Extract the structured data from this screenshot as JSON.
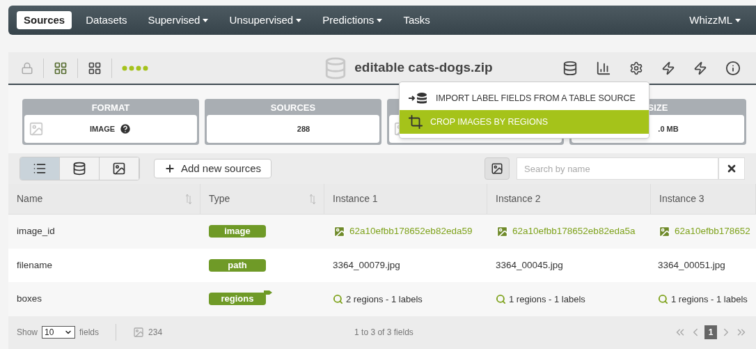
{
  "nav": {
    "items": [
      {
        "label": "Sources",
        "selected": true,
        "dropdown": false
      },
      {
        "label": "Datasets",
        "selected": false,
        "dropdown": false
      },
      {
        "label": "Supervised",
        "selected": false,
        "dropdown": true
      },
      {
        "label": "Unsupervised",
        "selected": false,
        "dropdown": true
      },
      {
        "label": "Predictions",
        "selected": false,
        "dropdown": true
      },
      {
        "label": "Tasks",
        "selected": false,
        "dropdown": false
      }
    ],
    "user": "WhizzML"
  },
  "toolbar": {
    "title": "editable cats-dogs.zip"
  },
  "menu": {
    "items": [
      {
        "label": "IMPORT LABEL FIELDS FROM A TABLE SOURCE",
        "selected": false,
        "kind": "import"
      },
      {
        "label": "CROP IMAGES BY REGIONS",
        "selected": true,
        "kind": "crop"
      }
    ]
  },
  "summary": [
    {
      "header": "FORMAT",
      "value": "IMAGE",
      "kind": "format"
    },
    {
      "header": "SOURCES",
      "value": "288",
      "kind": "plain"
    },
    {
      "kind": "hidden"
    },
    {
      "header": "SIZE",
      "value": ".0 MB",
      "kind": "plain"
    }
  ],
  "controls": {
    "views": [
      {
        "kind": "list",
        "selected": true
      },
      {
        "kind": "dataset",
        "selected": false
      },
      {
        "kind": "image",
        "selected": false
      }
    ],
    "add_button": "Add new sources",
    "search": {
      "placeholder": "Search by name"
    }
  },
  "table": {
    "columns": [
      {
        "label": "Name",
        "sortable": true
      },
      {
        "label": "Type",
        "sortable": true
      },
      {
        "label": "Instance 1",
        "sortable": false
      },
      {
        "label": "Instance 2",
        "sortable": false
      },
      {
        "label": "Instance 3",
        "sortable": false
      }
    ],
    "rows": [
      {
        "kind": "image",
        "cells": [
          "image_id",
          "image",
          "62a10efbb178652eb82eda59",
          "62a10efbb178652eb82eda5a",
          "62a10efbb178652"
        ]
      },
      {
        "kind": "text",
        "cells": [
          "filename",
          "path",
          "3364_00079.jpg",
          "3364_00045.jpg",
          "3364_00051.jpg"
        ]
      },
      {
        "kind": "regions",
        "cells": [
          "boxes",
          "regions",
          "2 regions - 1 labels",
          "1 regions - 1 labels",
          "1 regions - 1 labels"
        ]
      }
    ]
  },
  "footer": {
    "show_label": "Show",
    "page_size": "10",
    "fields_label": "fields",
    "image_count": "234",
    "range": "1 to 3 of 3 fields",
    "page": "1"
  }
}
